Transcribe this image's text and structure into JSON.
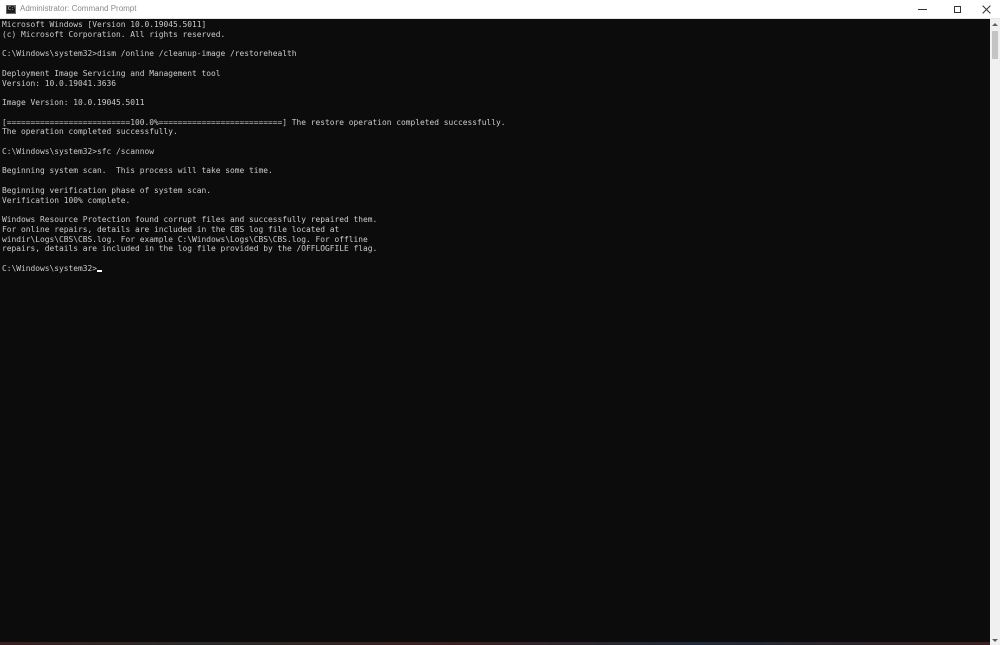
{
  "window": {
    "title": "Administrator: Command Prompt",
    "icon_name": "cmd-icon",
    "icon_glyph": "C:\\",
    "controls": {
      "minimize": "minimize-icon",
      "maximize": "maximize-icon",
      "close": "close-icon"
    }
  },
  "console": {
    "background_color": "#0c0c0c",
    "text_color": "#cccccc",
    "lines": [
      "Microsoft Windows [Version 10.0.19045.5011]",
      "(c) Microsoft Corporation. All rights reserved.",
      "",
      "C:\\Windows\\system32>dism /online /cleanup-image /restorehealth",
      "",
      "Deployment Image Servicing and Management tool",
      "Version: 10.0.19041.3636",
      "",
      "Image Version: 10.0.19045.5011",
      "",
      "[==========================100.0%==========================] The restore operation completed successfully.",
      "The operation completed successfully.",
      "",
      "C:\\Windows\\system32>sfc /scannow",
      "",
      "Beginning system scan.  This process will take some time.",
      "",
      "Beginning verification phase of system scan.",
      "Verification 100% complete.",
      "",
      "Windows Resource Protection found corrupt files and successfully repaired them.",
      "For online repairs, details are included in the CBS log file located at",
      "windir\\Logs\\CBS\\CBS.log. For example C:\\Windows\\Logs\\CBS\\CBS.log. For offline",
      "repairs, details are included in the log file provided by the /OFFLOGFILE flag.",
      ""
    ],
    "prompt": "C:\\Windows\\system32>"
  }
}
